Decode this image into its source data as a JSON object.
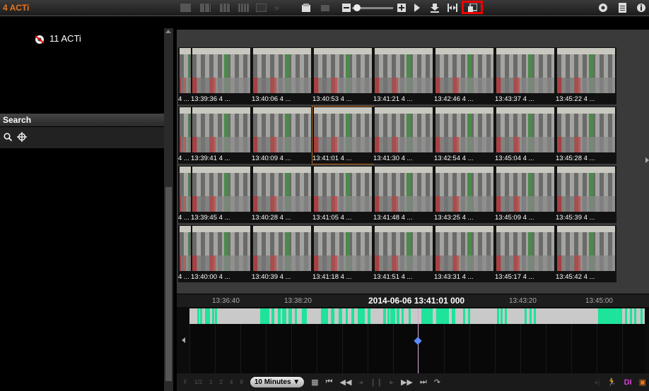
{
  "app": {
    "title": "4 ACTi"
  },
  "camera_tree": {
    "items": [
      {
        "label": "11 ACTi"
      }
    ]
  },
  "search": {
    "title": "Search"
  },
  "grid": {
    "rows": [
      [
        "4 ...",
        "13:39:36 4 ...",
        "13:40:06 4 ...",
        "13:40:53 4 ...",
        "13:41:21 4 ...",
        "13:42:46 4 ...",
        "13:43:37 4 ...",
        "13:45:22 4 ..."
      ],
      [
        "4 ...",
        "13:39:41 4 ...",
        "13:40:09 4 ...",
        "13:41:01 4 ...",
        "13:41:30 4 ...",
        "13:42:54 4 ...",
        "13:45:04 4 ...",
        "13:45:28 4 ..."
      ],
      [
        "4 ...",
        "13:39:45 4 ...",
        "13:40:28 4 ...",
        "13:41:05 4 ...",
        "13:41:48 4 ...",
        "13:43:25 4 ...",
        "13:45:09 4 ...",
        "13:45:39 4 ..."
      ],
      [
        "4 ...",
        "13:40:00 4 ...",
        "13:40:39 4 ...",
        "13:41:18 4 ...",
        "13:41:51 4 ...",
        "13:43:31 4 ...",
        "13:45:17 4 ...",
        "13:45:42 4 ..."
      ]
    ]
  },
  "timeline": {
    "ticks": [
      "13:36:40",
      "13:38:20",
      "13:43:20",
      "13:45:00"
    ],
    "current": "2014-06-06 13:41:01 000"
  },
  "bottombar": {
    "speed_f": "F",
    "speeds": [
      "1/2",
      "1",
      "2",
      "4",
      "8"
    ],
    "interval": "10 Minutes",
    "badge": "DI"
  },
  "colors": {
    "accent": "#e8761e",
    "motion": "#1ee39a",
    "highlight": "#e00000"
  }
}
